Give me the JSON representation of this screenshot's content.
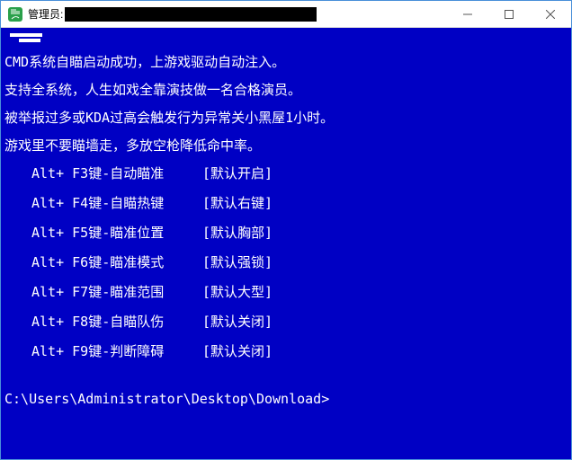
{
  "window": {
    "title_prefix": "管理员:"
  },
  "terminal": {
    "messages": [
      "CMD系统自瞄启动成功，上游戏驱动自动注入。",
      "支持全系统，人生如戏全靠演技做一名合格演员。",
      "被举报过多或KDA过高会触发行为异常关小黑屋1小时。",
      "游戏里不要瞄墙走，多放空枪降低命中率。"
    ],
    "hotkeys": [
      {
        "key": "Alt+ F3键-自动瞄准",
        "def": "[默认开启]"
      },
      {
        "key": "Alt+ F4键-自瞄热键",
        "def": "[默认右键]"
      },
      {
        "key": "Alt+ F5键-瞄准位置",
        "def": "[默认胸部]"
      },
      {
        "key": "Alt+ F6键-瞄准模式",
        "def": "[默认强锁]"
      },
      {
        "key": "Alt+ F7键-瞄准范围",
        "def": "[默认大型]"
      },
      {
        "key": "Alt+ F8键-自瞄队伤",
        "def": "[默认关闭]"
      },
      {
        "key": "Alt+ F9键-判断障碍",
        "def": "[默认关闭]"
      }
    ],
    "prompt": "C:\\Users\\Administrator\\Desktop\\Download>"
  }
}
